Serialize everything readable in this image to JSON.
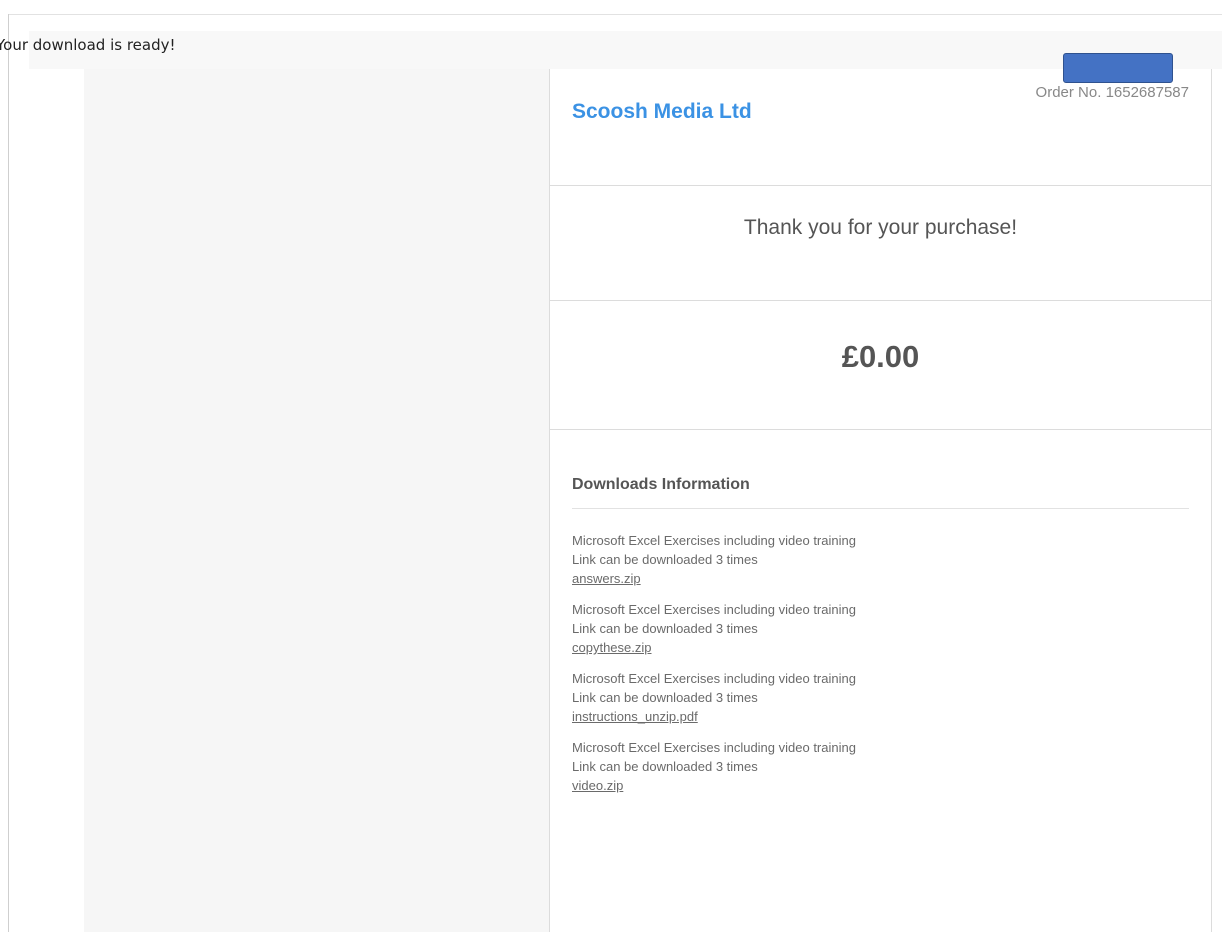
{
  "banner": {
    "title": "Your download is ready!"
  },
  "receipt": {
    "merchant": "Scoosh Media Ltd",
    "order_number": "Order No. 1652687587",
    "thanks": "Thank you for your purchase!",
    "amount": "£0.00",
    "downloads_heading": "Downloads Information",
    "downloads": [
      {
        "product": "Microsoft Excel Exercises including video training",
        "limit": "Link can be downloaded 3 times",
        "file": "answers.zip"
      },
      {
        "product": "Microsoft Excel Exercises including video training",
        "limit": "Link can be downloaded 3 times",
        "file": "copythese.zip"
      },
      {
        "product": "Microsoft Excel Exercises including video training",
        "limit": "Link can be downloaded 3 times",
        "file": "instructions_unzip.pdf"
      },
      {
        "product": "Microsoft Excel Exercises including video training",
        "limit": "Link can be downloaded 3 times",
        "file": "video.zip"
      }
    ]
  },
  "colors": {
    "brand": "#3b92e4",
    "redaction": "#4472c4"
  }
}
